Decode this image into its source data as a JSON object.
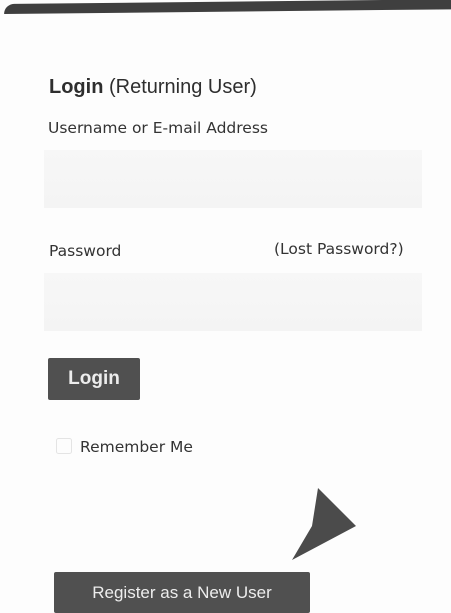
{
  "form": {
    "heading_bold": "Login",
    "heading_rest": " (Returning User)",
    "username_label": "Username or E-mail Address",
    "username_value": "",
    "password_label": "Password",
    "lost_password_link": "(Lost Password?)",
    "password_value": "",
    "login_button": "Login",
    "remember_me_label": "Remember Me",
    "remember_me_checked": false,
    "register_button": "Register as a New User"
  },
  "icons": {
    "pointer": "arrowhead-pointer-icon"
  },
  "colors": {
    "button_background": "#505050",
    "button_text": "#ededed",
    "text": "#333333",
    "field_background": "#f5f5f5",
    "top_bar": "#3f3f3f"
  }
}
